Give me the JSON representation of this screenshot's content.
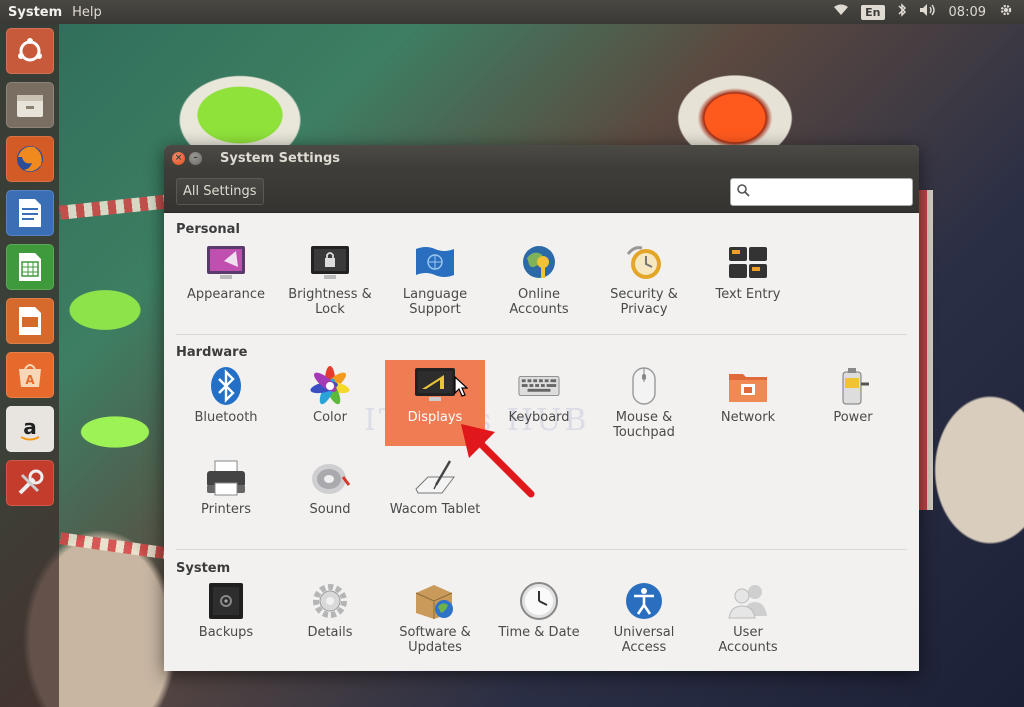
{
  "top_panel": {
    "app_name": "System",
    "menu_help": "Help",
    "lang": "En",
    "time": "08:09"
  },
  "window": {
    "title": "System Settings",
    "all_settings": "All Settings",
    "search_placeholder": ""
  },
  "watermark": "IT Pros HUB",
  "sections": {
    "personal": {
      "title": "Personal",
      "items": [
        {
          "label": "Appearance"
        },
        {
          "label": "Brightness &\nLock"
        },
        {
          "label": "Language\nSupport"
        },
        {
          "label": "Online\nAccounts"
        },
        {
          "label": "Security &\nPrivacy"
        },
        {
          "label": "Text Entry"
        }
      ]
    },
    "hardware": {
      "title": "Hardware",
      "items": [
        {
          "label": "Bluetooth"
        },
        {
          "label": "Color"
        },
        {
          "label": "Displays"
        },
        {
          "label": "Keyboard"
        },
        {
          "label": "Mouse &\nTouchpad"
        },
        {
          "label": "Network"
        },
        {
          "label": "Power"
        },
        {
          "label": "Printers"
        },
        {
          "label": "Sound"
        },
        {
          "label": "Wacom Tablet"
        }
      ]
    },
    "system": {
      "title": "System",
      "items": [
        {
          "label": "Backups"
        },
        {
          "label": "Details"
        },
        {
          "label": "Software &\nUpdates"
        },
        {
          "label": "Time & Date"
        },
        {
          "label": "Universal\nAccess"
        },
        {
          "label": "User\nAccounts"
        }
      ]
    }
  },
  "colors": {
    "selection": "#ef7c52",
    "accent_arrow": "#e0171b"
  }
}
